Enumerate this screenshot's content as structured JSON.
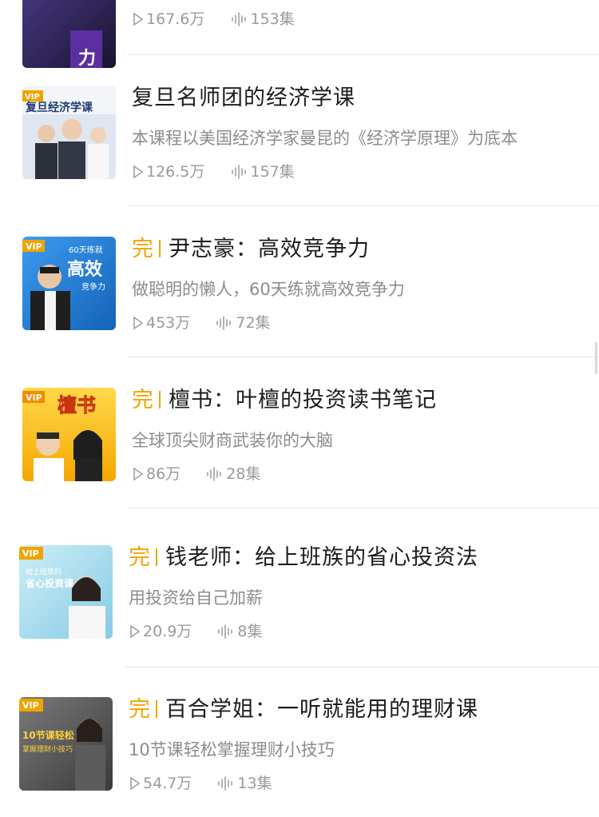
{
  "items": [
    {
      "title": "",
      "done": "",
      "desc": "",
      "plays": "167.6万",
      "episodes": "153集",
      "cover": {
        "vip": "",
        "text": "",
        "colors": [
          "#3a2a6a",
          "#1a1430"
        ]
      }
    },
    {
      "title": "复旦名师团的经济学课",
      "done": "",
      "desc": "本课程以美国经济学家曼昆的《经济学原理》为底本",
      "plays": "126.5万",
      "episodes": "157集",
      "cover": {
        "vip": "VIP",
        "text": "复旦经济学课",
        "colors": [
          "#e9eef5",
          "#c5d0de"
        ]
      }
    },
    {
      "title": "尹志豪：高效竞争力",
      "done": "完",
      "desc": "做聪明的懒人，60天练就高效竞争力",
      "plays": "453万",
      "episodes": "72集",
      "cover": {
        "vip": "VIP",
        "text": "高效",
        "sub": "60天练就",
        "sub2": "竞争力",
        "colors": [
          "#2f8fe0",
          "#1565c0"
        ]
      }
    },
    {
      "title": "檀书：叶檀的投资读书笔记",
      "done": "完",
      "desc": "全球顶尖财商武装你的大脑",
      "plays": "86万",
      "episodes": "28集",
      "cover": {
        "vip": "VIP",
        "text": "檀书",
        "colors": [
          "#ffd23a",
          "#f6a800"
        ]
      }
    },
    {
      "title": "钱老师：给上班族的省心投资法",
      "done": "完",
      "desc": "用投资给自己加薪",
      "plays": "20.9万",
      "episodes": "8集",
      "cover": {
        "vip": "VIP",
        "text": "省心投资课",
        "sub": "给上班族的",
        "colors": [
          "#bfe6f2",
          "#8ccfe6"
        ]
      }
    },
    {
      "title": "百合学姐：一听就能用的理财课",
      "done": "完",
      "desc": "10节课轻松掌握理财小技巧",
      "plays": "54.7万",
      "episodes": "13集",
      "cover": {
        "vip": "VIP",
        "text": "10节课轻松",
        "sub": "掌握理财小技巧",
        "colors": [
          "#6a6a6a",
          "#3e3e3e"
        ]
      }
    }
  ]
}
